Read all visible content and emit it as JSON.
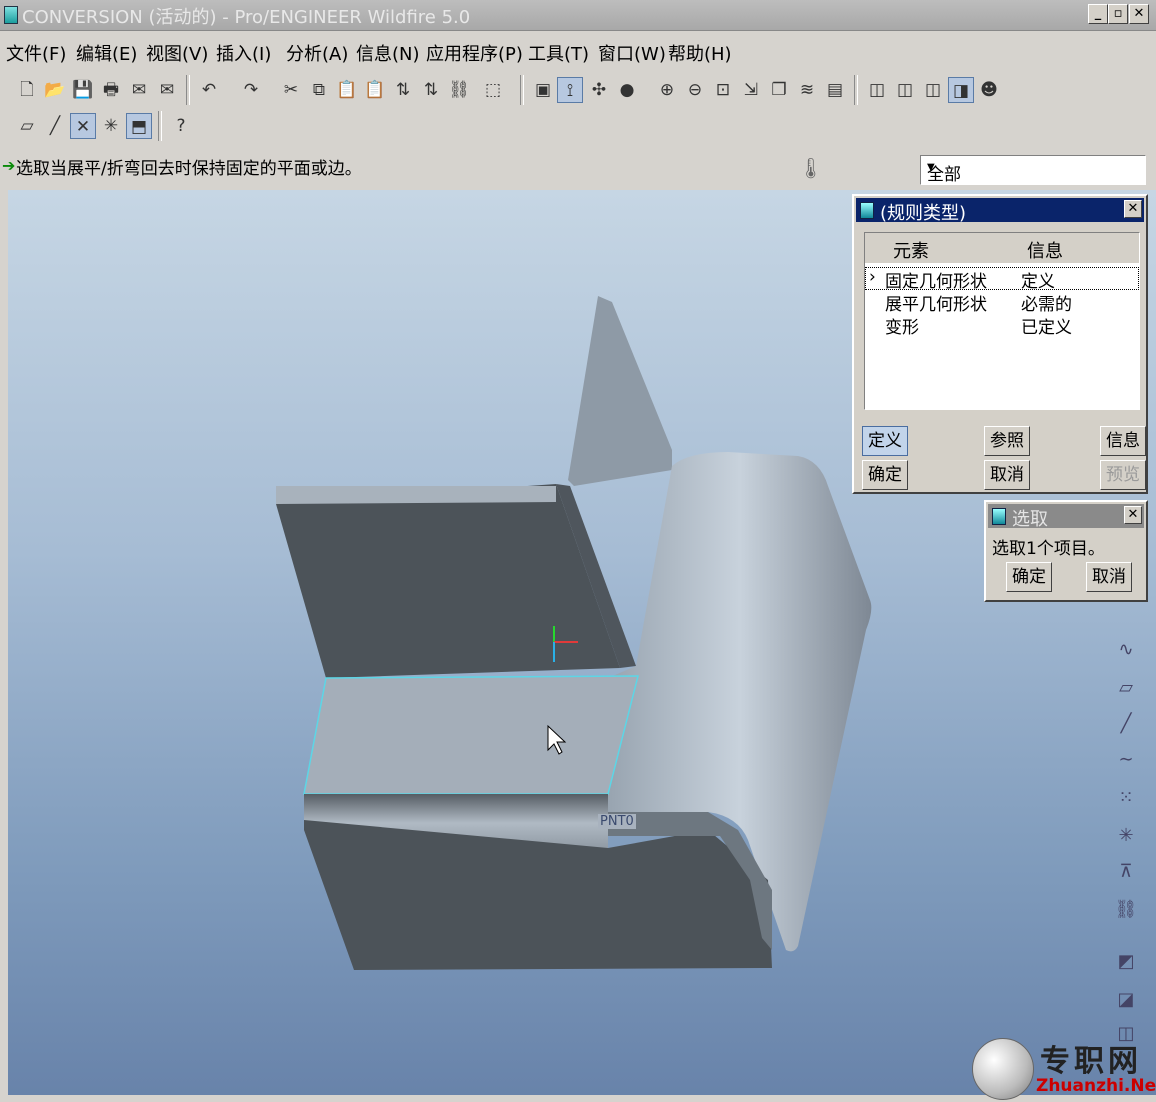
{
  "window": {
    "title": "CONVERSION (活动的) - Pro/ENGINEER Wildfire 5.0",
    "minimize": "_",
    "maximize": "▫",
    "close": "✕"
  },
  "menu": [
    "文件(F)",
    "编辑(E)",
    "视图(V)",
    "插入(I)",
    "分析(A)",
    "信息(N)",
    "应用程序(P)",
    "工具(T)",
    "窗口(W)",
    "帮助(H)"
  ],
  "message": "选取当展平/折弯回去时保持固定的平面或边。",
  "filter": {
    "selected": "全部"
  },
  "model": {
    "csys_label": "PNT0"
  },
  "rule_dialog": {
    "title": "(规则类型)",
    "columns": [
      "元素",
      "信息"
    ],
    "rows": [
      {
        "element": "固定几何形状",
        "info": "定义",
        "selected": true
      },
      {
        "element": "展平几何形状",
        "info": "必需的",
        "selected": false
      },
      {
        "element": "变形",
        "info": "已定义",
        "selected": false
      }
    ],
    "buttons": {
      "define": "定义",
      "refs": "参照",
      "info": "信息",
      "ok": "确定",
      "cancel": "取消",
      "preview": "预览"
    }
  },
  "select_dialog": {
    "title": "选取",
    "prompt": "选取1个项目。",
    "ok": "确定",
    "cancel": "取消"
  },
  "watermark": {
    "cn": "专职网",
    "en": "Zhuanzhi.Net"
  },
  "colors": {
    "title_active": "#0a246a",
    "title_inactive": "#808080",
    "surface_edge": "#5cd6e6"
  }
}
